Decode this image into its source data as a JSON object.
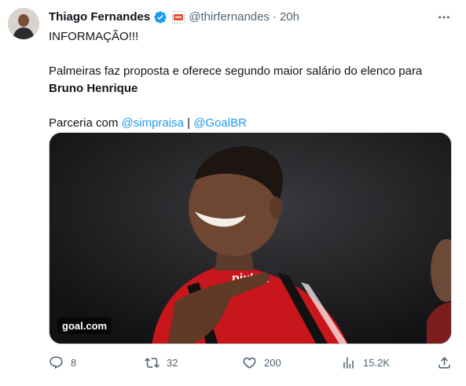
{
  "author": {
    "display_name": "Thiago Fernandes",
    "handle": "@thirfernandes",
    "separator": "·",
    "timestamp": "20h",
    "verified_color": "#1d9bf0"
  },
  "tweet": {
    "line1": "INFORMAÇÃO!!!",
    "line2": "Palmeiras faz proposta e oferece segundo maior salário do elenco para",
    "line3": "Bruno Henrique",
    "line4_prefix": "Parceria com ",
    "mention1": "@simpraisa",
    "separator": " | ",
    "mention2": "@GoalBR"
  },
  "media": {
    "watermark": "goal.com",
    "shirt_sponsor": "pixbet"
  },
  "actions": {
    "replies": "8",
    "retweets": "32",
    "likes": "200",
    "views": "15.2K"
  },
  "colors": {
    "accent": "#1d9bf0",
    "secondary_text": "#536471",
    "primary_text": "#0f1419"
  }
}
